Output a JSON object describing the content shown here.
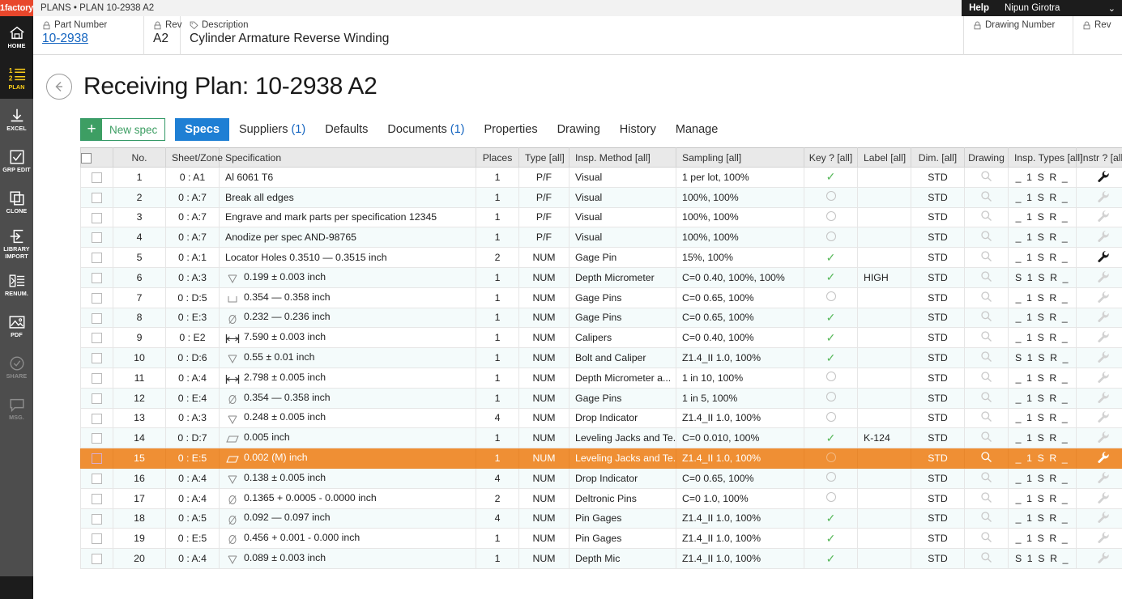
{
  "topbar": {
    "brand": "1factory",
    "breadcrumb": "PLANS • PLAN 10-2938 A2",
    "help_label": "Help",
    "user_name": "Nipun Girotra",
    "caret": "chevron-down"
  },
  "rail": {
    "items": [
      {
        "label": "HOME",
        "label2": "",
        "icon": "home-icon",
        "state": "dark"
      },
      {
        "label": "PLAN",
        "label2": "",
        "icon": "plan-list-icon",
        "state": "active"
      },
      {
        "label": "EXCEL",
        "label2": "",
        "icon": "download-icon",
        "state": "normal"
      },
      {
        "label": "GRP EDIT",
        "label2": "",
        "icon": "checkbox-icon",
        "state": "normal"
      },
      {
        "label": "CLONE",
        "label2": "",
        "icon": "copy-icon",
        "state": "normal"
      },
      {
        "label": "LIBRARY",
        "label2": "IMPORT",
        "icon": "import-arrow-icon",
        "state": "normal"
      },
      {
        "label": "RENUM.",
        "label2": "",
        "icon": "renumber-icon",
        "state": "normal"
      },
      {
        "label": "PDF",
        "label2": "",
        "icon": "image-icon",
        "state": "normal"
      },
      {
        "label": "SHARE",
        "label2": "",
        "icon": "share-check-icon",
        "state": "dim"
      },
      {
        "label": "MSG.",
        "label2": "",
        "icon": "message-icon",
        "state": "dim"
      }
    ]
  },
  "part_header": {
    "part_number_label": "Part Number",
    "part_number_value": "10-2938",
    "rev_label": "Rev",
    "rev_value": "A2",
    "description_label": "Description",
    "description_value": "Cylinder Armature Reverse Winding",
    "drawing_number_label": "Drawing Number",
    "drawing_number_value": "",
    "rev2_label": "Rev",
    "rev2_value": ""
  },
  "page": {
    "back_icon": "back-arrow-icon",
    "title": "Receiving Plan: 10-2938 A2"
  },
  "toolbar": {
    "new_spec_plus": "+",
    "new_spec_label": "New spec"
  },
  "tabs": [
    {
      "label": "Specs",
      "count": "",
      "active": true
    },
    {
      "label": "Suppliers",
      "count": "(1)",
      "active": false
    },
    {
      "label": "Defaults",
      "count": "",
      "active": false
    },
    {
      "label": "Documents",
      "count": "(1)",
      "active": false
    },
    {
      "label": "Properties",
      "count": "",
      "active": false
    },
    {
      "label": "Drawing",
      "count": "",
      "active": false
    },
    {
      "label": "History",
      "count": "",
      "active": false
    },
    {
      "label": "Manage",
      "count": "",
      "active": false
    }
  ],
  "table": {
    "headers": {
      "select_all": "checkbox",
      "no": "No.",
      "sheet_zone": "Sheet/Zone",
      "specification": "Specification",
      "places": "Places",
      "type": "Type [all]",
      "insp_method": "Insp. Method [all]",
      "sampling": "Sampling [all]",
      "key": "Key ? [all]",
      "label": "Label [all]",
      "dim": "Dim. [all]",
      "drawing": "Drawing",
      "insp_types": "Insp. Types [all]",
      "instr": "Instr ? [all]",
      "menu": "kebab-menu"
    },
    "rows": [
      {
        "no": "1",
        "sheet_zone": "0 : A1",
        "symbol": "none",
        "spec": "Al 6061 T6",
        "places": "1",
        "type": "P/F",
        "insp_method": "Visual",
        "sampling": "1 per lot, 100%",
        "key": "check",
        "label": "",
        "dim": "STD",
        "insp_types": "_ 1 S R _",
        "instr": "dark",
        "selected": false
      },
      {
        "no": "2",
        "sheet_zone": "0 : A:7",
        "symbol": "none",
        "spec": "Break all edges",
        "places": "1",
        "type": "P/F",
        "insp_method": "Visual",
        "sampling": "100%, 100%",
        "key": "ring",
        "label": "",
        "dim": "STD",
        "insp_types": "_ 1 S R _",
        "instr": "light",
        "selected": false
      },
      {
        "no": "3",
        "sheet_zone": "0 : A:7",
        "symbol": "none",
        "spec": "Engrave and mark parts per specification 12345",
        "places": "1",
        "type": "P/F",
        "insp_method": "Visual",
        "sampling": "100%, 100%",
        "key": "ring",
        "label": "",
        "dim": "STD",
        "insp_types": "_ 1 S R _",
        "instr": "light",
        "selected": false
      },
      {
        "no": "4",
        "sheet_zone": "0 : A:7",
        "symbol": "none",
        "spec": "Anodize per spec AND-98765",
        "places": "1",
        "type": "P/F",
        "insp_method": "Visual",
        "sampling": "100%, 100%",
        "key": "ring",
        "label": "",
        "dim": "STD",
        "insp_types": "_ 1 S R _",
        "instr": "light",
        "selected": false
      },
      {
        "no": "5",
        "sheet_zone": "0 : A:1",
        "symbol": "none",
        "spec": "Locator Holes  0.3510 — 0.3515  inch",
        "places": "2",
        "type": "NUM",
        "insp_method": "Gage Pin",
        "sampling": "15%, 100%",
        "key": "check",
        "label": "",
        "dim": "STD",
        "insp_types": "_ 1 S R _",
        "instr": "dark",
        "selected": false
      },
      {
        "no": "6",
        "sheet_zone": "0 : A:3",
        "symbol": "depth",
        "spec": "0.199 ± 0.003  inch",
        "places": "1",
        "type": "NUM",
        "insp_method": "Depth Micrometer",
        "sampling": "C=0 0.40, 100%, 100%",
        "key": "check",
        "label": "HIGH",
        "dim": "STD",
        "insp_types": "S 1 S R _",
        "instr": "light",
        "selected": false
      },
      {
        "no": "7",
        "sheet_zone": "0 : D:5",
        "symbol": "cbore",
        "spec": "0.354 — 0.358  inch",
        "places": "1",
        "type": "NUM",
        "insp_method": "Gage Pins",
        "sampling": "C=0 0.65, 100%",
        "key": "ring",
        "label": "",
        "dim": "STD",
        "insp_types": "_ 1 S R _",
        "instr": "light",
        "selected": false
      },
      {
        "no": "8",
        "sheet_zone": "0 : E:3",
        "symbol": "dia",
        "spec": "0.232 — 0.236  inch",
        "places": "1",
        "type": "NUM",
        "insp_method": "Gage Pins",
        "sampling": "C=0 0.65, 100%",
        "key": "check",
        "label": "",
        "dim": "STD",
        "insp_types": "_ 1 S R _",
        "instr": "light",
        "selected": false
      },
      {
        "no": "9",
        "sheet_zone": "0 : E2",
        "symbol": "linear",
        "spec": "7.590 ± 0.003  inch",
        "places": "1",
        "type": "NUM",
        "insp_method": "Calipers",
        "sampling": "C=0 0.40, 100%",
        "key": "check",
        "label": "",
        "dim": "STD",
        "insp_types": "_ 1 S R _",
        "instr": "light",
        "selected": false
      },
      {
        "no": "10",
        "sheet_zone": "0 : D:6",
        "symbol": "depth",
        "spec": "0.55 ± 0.01  inch",
        "places": "1",
        "type": "NUM",
        "insp_method": "Bolt and Caliper",
        "sampling": "Z1.4_II 1.0, 100%",
        "key": "check",
        "label": "",
        "dim": "STD",
        "insp_types": "S 1 S R _",
        "instr": "light",
        "selected": false
      },
      {
        "no": "11",
        "sheet_zone": "0 : A:4",
        "symbol": "linear",
        "spec": "2.798 ± 0.005  inch",
        "places": "1",
        "type": "NUM",
        "insp_method": "Depth Micrometer a...",
        "sampling": "1 in 10, 100%",
        "key": "ring",
        "label": "",
        "dim": "STD",
        "insp_types": "_ 1 S R _",
        "instr": "light",
        "selected": false
      },
      {
        "no": "12",
        "sheet_zone": "0 : E:4",
        "symbol": "dia",
        "spec": "0.354 — 0.358  inch",
        "places": "1",
        "type": "NUM",
        "insp_method": "Gage Pins",
        "sampling": "1 in 5, 100%",
        "key": "ring",
        "label": "",
        "dim": "STD",
        "insp_types": "_ 1 S R _",
        "instr": "light",
        "selected": false
      },
      {
        "no": "13",
        "sheet_zone": "0 : A:3",
        "symbol": "depth",
        "spec": "0.248 ± 0.005  inch",
        "places": "4",
        "type": "NUM",
        "insp_method": "Drop Indicator",
        "sampling": "Z1.4_II 1.0, 100%",
        "key": "ring",
        "label": "",
        "dim": "STD",
        "insp_types": "_ 1 S R _",
        "instr": "light",
        "selected": false
      },
      {
        "no": "14",
        "sheet_zone": "0 : D:7",
        "symbol": "para",
        "spec": "0.005  inch",
        "places": "1",
        "type": "NUM",
        "insp_method": "Leveling Jacks and Te...",
        "sampling": "C=0 0.010, 100%",
        "key": "check",
        "label": "K-124",
        "dim": "STD",
        "insp_types": "_ 1 S R _",
        "instr": "light",
        "selected": false
      },
      {
        "no": "15",
        "sheet_zone": "0 : E:5",
        "symbol": "para",
        "spec": "0.002 (M)  inch",
        "places": "1",
        "type": "NUM",
        "insp_method": "Leveling Jacks and Te...",
        "sampling": "Z1.4_II 1.0, 100%",
        "key": "ring",
        "label": "",
        "dim": "STD",
        "insp_types": "_ 1 S R _",
        "instr": "dark",
        "selected": true
      },
      {
        "no": "16",
        "sheet_zone": "0 : A:4",
        "symbol": "depth",
        "spec": "0.138 ± 0.005  inch",
        "places": "4",
        "type": "NUM",
        "insp_method": "Drop Indicator",
        "sampling": "C=0 0.65, 100%",
        "key": "ring",
        "label": "",
        "dim": "STD",
        "insp_types": "_ 1 S R _",
        "instr": "light",
        "selected": false
      },
      {
        "no": "17",
        "sheet_zone": "0 : A:4",
        "symbol": "dia",
        "spec": "0.1365 + 0.0005 - 0.0000  inch",
        "places": "2",
        "type": "NUM",
        "insp_method": "Deltronic Pins",
        "sampling": "C=0 1.0, 100%",
        "key": "ring",
        "label": "",
        "dim": "STD",
        "insp_types": "_ 1 S R _",
        "instr": "light",
        "selected": false
      },
      {
        "no": "18",
        "sheet_zone": "0 : A:5",
        "symbol": "dia",
        "spec": "0.092 — 0.097  inch",
        "places": "4",
        "type": "NUM",
        "insp_method": "Pin Gages",
        "sampling": "Z1.4_II 1.0, 100%",
        "key": "check",
        "label": "",
        "dim": "STD",
        "insp_types": "_ 1 S R _",
        "instr": "light",
        "selected": false
      },
      {
        "no": "19",
        "sheet_zone": "0 : E:5",
        "symbol": "dia",
        "spec": "0.456 + 0.001 - 0.000  inch",
        "places": "1",
        "type": "NUM",
        "insp_method": "Pin Gages",
        "sampling": "Z1.4_II 1.0, 100%",
        "key": "check",
        "label": "",
        "dim": "STD",
        "insp_types": "_ 1 S R _",
        "instr": "light",
        "selected": false
      },
      {
        "no": "20",
        "sheet_zone": "0 : A:4",
        "symbol": "depth",
        "spec": "0.089 ± 0.003  inch",
        "places": "1",
        "type": "NUM",
        "insp_method": "Depth Mic",
        "sampling": "Z1.4_II 1.0, 100%",
        "key": "check",
        "label": "",
        "dim": "STD",
        "insp_types": "S 1 S R _",
        "instr": "light",
        "selected": false
      }
    ]
  },
  "colors": {
    "brand_red": "#e8472c",
    "accent_blue": "#1e7fd4",
    "green": "#3d9e63",
    "selected_orange": "#ef8f34",
    "rail_gray": "#4d4d4d",
    "rail_dark": "#1c1c1c",
    "plan_yellow": "#ffd11a"
  }
}
